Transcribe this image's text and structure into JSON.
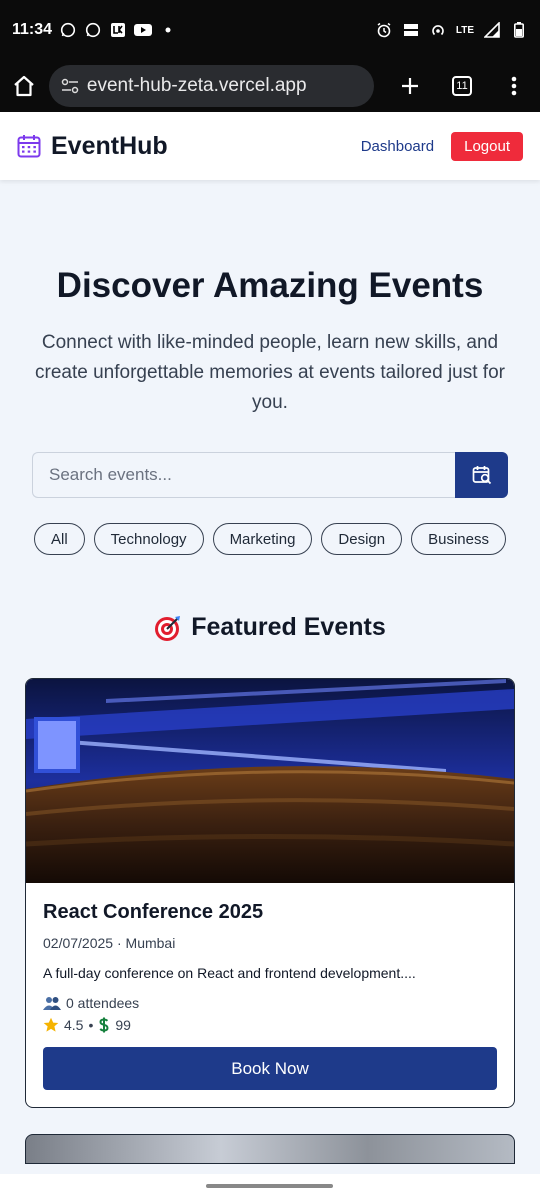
{
  "status_bar": {
    "time": "11:34",
    "network": "LTE",
    "icons": [
      "whatsapp-icon",
      "whatsapp-icon",
      "lk-app-icon",
      "youtube-icon",
      "alarm-icon",
      "volte-icon",
      "hotspot-icon",
      "signal-icon",
      "battery-icon"
    ]
  },
  "browser": {
    "url": "event-hub-zeta.vercel.app",
    "tab_count": "11"
  },
  "nav": {
    "brand": "EventHub",
    "dashboard": "Dashboard",
    "logout": "Logout"
  },
  "hero": {
    "title": "Discover Amazing Events",
    "subtitle": "Connect with like-minded people, learn new skills, and create unforgettable memories at events tailored just for you."
  },
  "search": {
    "placeholder": "Search events..."
  },
  "categories": [
    "All",
    "Technology",
    "Marketing",
    "Design",
    "Business"
  ],
  "featured": {
    "title": "Featured Events"
  },
  "event": {
    "title": "React Conference 2025",
    "date": "02/07/2025",
    "location": "Mumbai",
    "description": "A full-day conference on React and frontend development....",
    "attendees": "0 attendees",
    "rating": "4.5",
    "price": "99",
    "button": "Book Now"
  },
  "colors": {
    "primary": "#1e3a8a",
    "danger": "#ef2b3b",
    "page_bg": "#f1f5fb"
  }
}
